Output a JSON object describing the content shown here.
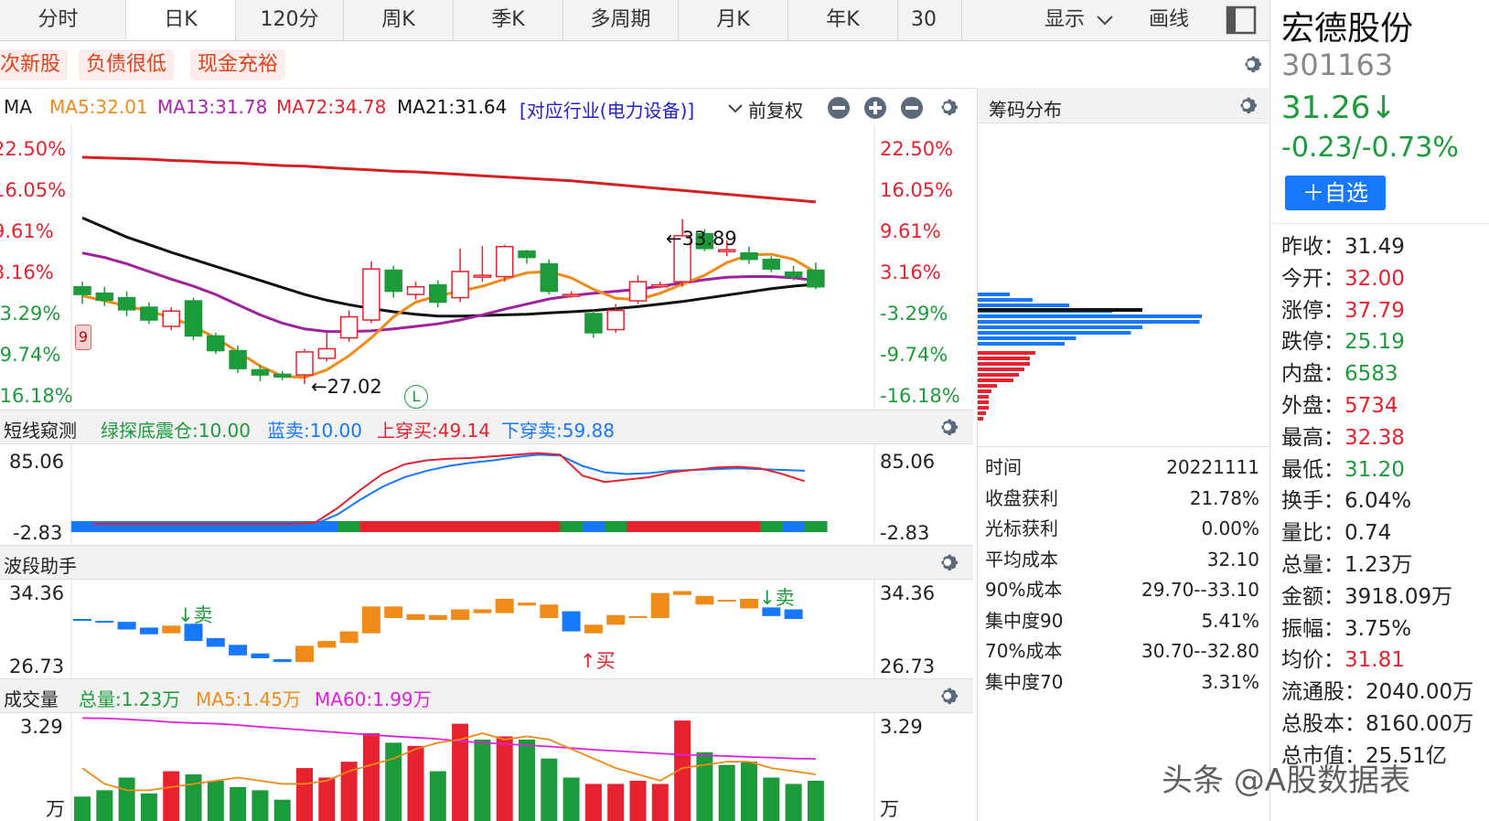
{
  "tabs": [
    "分时",
    "日K",
    "120分",
    "周K",
    "季K",
    "多周期",
    "月K",
    "年K",
    "30"
  ],
  "active_tab": 1,
  "tab_extra": {
    "display": "显示",
    "draw": "画线"
  },
  "tags": [
    "次新股",
    "负债很低",
    "现金充裕"
  ],
  "ma_header": {
    "label": "MA",
    "ma5": "MA5:32.01",
    "ma13": "MA13:31.78",
    "ma72": "MA72:34.78",
    "ma21": "MA21:31.64",
    "industry": "[对应行业(电力设备)]",
    "adjust": "前复权"
  },
  "colors": {
    "red": "#e8212e",
    "green": "#1c9b3b",
    "blue": "#1677ff",
    "orange": "#f08a18",
    "purple": "#a020a0",
    "black": "#111111"
  },
  "main_axis": [
    "22.50%",
    "16.05%",
    "9.61%",
    "3.16%",
    "-3.29%",
    "-9.74%",
    "-16.18%"
  ],
  "main_annotations": {
    "high": "←33.89",
    "low": "←27.02",
    "badge": "9",
    "circle": "L"
  },
  "candles": [
    {
      "o": 1.2,
      "c": 0.0,
      "h": 2.0,
      "l": -1.5
    },
    {
      "o": 0.2,
      "c": -0.9,
      "h": 1.2,
      "l": -1.8
    },
    {
      "o": -0.5,
      "c": -2.4,
      "h": 0.5,
      "l": -3.4
    },
    {
      "o": -2.0,
      "c": -4.0,
      "h": -1.2,
      "l": -4.6
    },
    {
      "o": -5.0,
      "c": -2.6,
      "h": -2.0,
      "l": -5.6
    },
    {
      "o": -1.0,
      "c": -6.5,
      "h": -0.5,
      "l": -7.2
    },
    {
      "o": -6.5,
      "c": -8.8,
      "h": -6.0,
      "l": -9.3
    },
    {
      "o": -8.8,
      "c": -11.6,
      "h": -8.0,
      "l": -12.3
    },
    {
      "o": -11.8,
      "c": -12.6,
      "h": -11.0,
      "l": -13.6
    },
    {
      "o": -12.5,
      "c": -12.9,
      "h": -12.0,
      "l": -13.4
    },
    {
      "o": -12.6,
      "c": -9.0,
      "h": -8.5,
      "l": -14.0
    },
    {
      "o": -10.0,
      "c": -8.5,
      "h": -6.0,
      "l": -10.5
    },
    {
      "o": -6.8,
      "c": -3.5,
      "h": -2.5,
      "l": -7.4
    },
    {
      "o": -4.0,
      "c": 4.0,
      "h": 5.2,
      "l": -4.5
    },
    {
      "o": 3.8,
      "c": 0.5,
      "h": 4.5,
      "l": -0.5
    },
    {
      "o": 0.0,
      "c": 1.2,
      "h": 2.0,
      "l": -0.8
    },
    {
      "o": 1.5,
      "c": -1.2,
      "h": 2.2,
      "l": -2.0
    },
    {
      "o": -0.5,
      "c": 3.6,
      "h": 7.2,
      "l": -1.2
    },
    {
      "o": 3.0,
      "c": 3.0,
      "h": 7.6,
      "l": 2.0
    },
    {
      "o": 2.8,
      "c": 7.5,
      "h": 7.8,
      "l": 2.0
    },
    {
      "o": 6.8,
      "c": 5.8,
      "h": 7.0,
      "l": 4.8
    },
    {
      "o": 4.8,
      "c": 0.5,
      "h": 5.5,
      "l": 0.0
    },
    {
      "o": 0.0,
      "c": 0.0,
      "h": 0.5,
      "l": -0.5
    },
    {
      "o": -3.0,
      "c": -6.0,
      "h": -2.5,
      "l": -6.8
    },
    {
      "o": -5.5,
      "c": -2.5,
      "h": -1.5,
      "l": -6.0
    },
    {
      "o": -1.0,
      "c": 2.0,
      "h": 3.0,
      "l": -1.5
    },
    {
      "o": 1.5,
      "c": 1.5,
      "h": 2.0,
      "l": 1.0
    },
    {
      "o": 2.0,
      "c": 9.2,
      "h": 11.8,
      "l": 1.2
    },
    {
      "o": 9.5,
      "c": 7.2,
      "h": 10.2,
      "l": 6.8
    },
    {
      "o": 7.0,
      "c": 7.0,
      "h": 8.5,
      "l": 6.0
    },
    {
      "o": 6.5,
      "c": 5.5,
      "h": 7.5,
      "l": 4.8
    },
    {
      "o": 5.5,
      "c": 4.0,
      "h": 6.0,
      "l": 3.5
    },
    {
      "o": 3.5,
      "c": 2.8,
      "h": 4.5,
      "l": 2.2
    },
    {
      "o": 3.8,
      "c": 1.2,
      "h": 5.0,
      "l": 0.8
    }
  ],
  "ma_lines": {
    "ma72": [
      21.5,
      21.4,
      21.3,
      21.2,
      21.0,
      20.9,
      20.7,
      20.6,
      20.4,
      20.2,
      20.1,
      19.9,
      19.7,
      19.5,
      19.3,
      19.2,
      19.0,
      18.8,
      18.6,
      18.4,
      18.2,
      18.0,
      17.8,
      17.5,
      17.2,
      16.9,
      16.6,
      16.3,
      16.0,
      15.7,
      15.4,
      15.1,
      14.8,
      14.5
    ],
    "ma21": [
      12.0,
      10.5,
      9.0,
      7.8,
      6.6,
      5.5,
      4.4,
      3.3,
      2.2,
      1.1,
      0.0,
      -0.9,
      -1.6,
      -2.2,
      -2.7,
      -3.1,
      -3.4,
      -3.4,
      -3.3,
      -3.2,
      -3.1,
      -2.9,
      -2.7,
      -2.5,
      -2.2,
      -1.9,
      -1.5,
      -1.1,
      -0.6,
      -0.1,
      0.4,
      0.9,
      1.3,
      1.6
    ],
    "ma13": [
      6.5,
      5.8,
      4.8,
      3.6,
      2.4,
      1.3,
      0.0,
      -1.6,
      -3.2,
      -4.5,
      -5.4,
      -5.8,
      -5.8,
      -5.7,
      -5.4,
      -5.0,
      -4.6,
      -4.0,
      -3.2,
      -2.3,
      -1.5,
      -0.7,
      -0.2,
      0.2,
      0.5,
      0.8,
      1.3,
      1.8,
      2.3,
      2.7,
      2.8,
      2.8,
      2.6,
      2.2
    ],
    "ma5": [
      -0.2,
      -1.0,
      -1.8,
      -2.6,
      -3.6,
      -5.0,
      -6.8,
      -9.0,
      -11.2,
      -12.8,
      -13.0,
      -11.8,
      -9.6,
      -6.8,
      -3.5,
      -1.2,
      -0.2,
      0.5,
      1.3,
      2.4,
      3.4,
      3.6,
      2.6,
      0.8,
      -0.6,
      -0.8,
      0.2,
      1.6,
      3.0,
      5.0,
      6.2,
      6.3,
      5.5,
      3.5
    ]
  },
  "chip_header": "筹码分布",
  "chip_bars": {
    "blue": [
      14,
      24,
      40,
      59,
      98,
      97,
      72,
      67,
      43,
      38
    ],
    "red": [
      21,
      19,
      19,
      17,
      15,
      13,
      7,
      5,
      4,
      4,
      4,
      3,
      2
    ]
  },
  "chip_stats": [
    {
      "k": "时间",
      "v": "20221111"
    },
    {
      "k": "收盘获利",
      "v": "21.78%"
    },
    {
      "k": "光标获利",
      "v": "0.00%"
    },
    {
      "k": "平均成本",
      "v": "32.10"
    },
    {
      "k": "90%成本",
      "v": "29.70--33.10"
    },
    {
      "k": "集中度90",
      "v": "5.41%"
    },
    {
      "k": "70%成本",
      "v": "30.70--32.80"
    },
    {
      "k": "集中度70",
      "v": "3.31%"
    }
  ],
  "short_panel": {
    "title": "短线窥测",
    "g": "绿探底震仓:10.00",
    "b": "蓝卖:10.00",
    "r": "上穿买:49.14",
    "p": "下穿卖:59.88",
    "axis_top": "85.06",
    "axis_bot": "-2.83",
    "red_line": [
      0,
      0,
      0,
      0,
      0,
      0,
      0,
      0,
      0,
      0,
      2,
      20,
      42,
      62,
      74,
      79,
      81,
      82,
      84,
      86,
      88,
      86,
      60,
      52,
      55,
      58,
      64,
      67,
      70,
      71,
      69,
      62,
      53
    ],
    "blue_line": [
      0,
      0,
      0,
      0,
      0,
      0,
      0,
      0,
      0,
      0,
      0,
      12,
      30,
      46,
      58,
      66,
      72,
      76,
      79,
      83,
      86,
      85,
      72,
      64,
      62,
      63,
      66,
      67,
      68,
      69,
      68,
      67,
      66
    ],
    "band": [
      "b",
      "b",
      "b",
      "b",
      "b",
      "b",
      "b",
      "b",
      "b",
      "b",
      "b",
      "b",
      "g",
      "r",
      "r",
      "r",
      "r",
      "r",
      "r",
      "r",
      "r",
      "r",
      "g",
      "b",
      "g",
      "r",
      "r",
      "r",
      "r",
      "r",
      "r",
      "g",
      "b",
      "g"
    ]
  },
  "wave_panel": {
    "title": "波段助手",
    "axis_top": "34.36",
    "axis_bot": "26.73",
    "sell1": "↓卖",
    "sell2": "↓卖",
    "buy": "↑买",
    "bars": [
      {
        "c": "b",
        "a": 31.5,
        "b": 31.3
      },
      {
        "c": "b",
        "a": 31.3,
        "b": 31.2
      },
      {
        "c": "b",
        "a": 31.2,
        "b": 30.4
      },
      {
        "c": "b",
        "a": 30.6,
        "b": 29.9
      },
      {
        "c": "o",
        "a": 30.8,
        "b": 30.0
      },
      {
        "c": "b",
        "a": 31.0,
        "b": 29.2
      },
      {
        "c": "b",
        "a": 29.5,
        "b": 28.6
      },
      {
        "c": "b",
        "a": 28.8,
        "b": 27.7
      },
      {
        "c": "b",
        "a": 27.9,
        "b": 27.4
      },
      {
        "c": "b",
        "a": 27.3,
        "b": 27.0
      },
      {
        "c": "o",
        "a": 27.0,
        "b": 28.7
      },
      {
        "c": "o",
        "a": 28.5,
        "b": 29.2
      },
      {
        "c": "o",
        "a": 29.0,
        "b": 30.2
      },
      {
        "c": "o",
        "a": 30.0,
        "b": 32.8
      },
      {
        "c": "o",
        "a": 31.6,
        "b": 32.8
      },
      {
        "c": "o",
        "a": 31.4,
        "b": 32.0
      },
      {
        "c": "o",
        "a": 31.4,
        "b": 31.9
      },
      {
        "c": "o",
        "a": 31.4,
        "b": 32.5
      },
      {
        "c": "o",
        "a": 32.1,
        "b": 32.5
      },
      {
        "c": "o",
        "a": 32.1,
        "b": 33.6
      },
      {
        "c": "o",
        "a": 32.9,
        "b": 33.2
      },
      {
        "c": "o",
        "a": 31.6,
        "b": 33.0
      },
      {
        "c": "b",
        "a": 32.3,
        "b": 30.2
      },
      {
        "c": "o",
        "a": 30.0,
        "b": 30.9
      },
      {
        "c": "o",
        "a": 30.9,
        "b": 31.9
      },
      {
        "c": "o",
        "a": 31.6,
        "b": 31.8
      },
      {
        "c": "o",
        "a": 31.6,
        "b": 34.2
      },
      {
        "c": "o",
        "a": 34.0,
        "b": 34.4
      },
      {
        "c": "o",
        "a": 33.9,
        "b": 33.0
      },
      {
        "c": "o",
        "a": 33.5,
        "b": 33.3
      },
      {
        "c": "o",
        "a": 33.6,
        "b": 32.6
      },
      {
        "c": "b",
        "a": 32.7,
        "b": 31.8
      },
      {
        "c": "b",
        "a": 32.5,
        "b": 31.5
      }
    ]
  },
  "vol_panel": {
    "title": "成交量",
    "total": "总量:1.23万",
    "ma5": "MA5:1.45万",
    "ma60": "MA60:1.99万",
    "axis_top": "3.29",
    "unit": "万",
    "bars": [
      {
        "v": 0.8,
        "c": "g"
      },
      {
        "v": 1.0,
        "c": "g"
      },
      {
        "v": 1.4,
        "c": "g"
      },
      {
        "v": 0.9,
        "c": "g"
      },
      {
        "v": 1.6,
        "c": "r"
      },
      {
        "v": 1.5,
        "c": "g"
      },
      {
        "v": 1.3,
        "c": "g"
      },
      {
        "v": 1.1,
        "c": "g"
      },
      {
        "v": 1.0,
        "c": "g"
      },
      {
        "v": 0.7,
        "c": "g"
      },
      {
        "v": 1.7,
        "c": "r"
      },
      {
        "v": 1.4,
        "c": "r"
      },
      {
        "v": 1.9,
        "c": "r"
      },
      {
        "v": 2.8,
        "c": "r"
      },
      {
        "v": 2.5,
        "c": "g"
      },
      {
        "v": 2.4,
        "c": "r"
      },
      {
        "v": 1.6,
        "c": "g"
      },
      {
        "v": 3.1,
        "c": "r"
      },
      {
        "v": 2.6,
        "c": "g"
      },
      {
        "v": 2.7,
        "c": "r"
      },
      {
        "v": 2.6,
        "c": "g"
      },
      {
        "v": 2.0,
        "c": "g"
      },
      {
        "v": 1.4,
        "c": "g"
      },
      {
        "v": 1.2,
        "c": "r"
      },
      {
        "v": 1.2,
        "c": "r"
      },
      {
        "v": 1.3,
        "c": "r"
      },
      {
        "v": 1.2,
        "c": "r"
      },
      {
        "v": 3.2,
        "c": "r"
      },
      {
        "v": 2.2,
        "c": "g"
      },
      {
        "v": 1.8,
        "c": "g"
      },
      {
        "v": 1.9,
        "c": "g"
      },
      {
        "v": 1.4,
        "c": "g"
      },
      {
        "v": 1.2,
        "c": "g"
      },
      {
        "v": 1.3,
        "c": "g"
      }
    ],
    "ma5_line": [
      1.7,
      1.2,
      1.0,
      1.0,
      1.1,
      1.2,
      1.3,
      1.4,
      1.3,
      1.2,
      1.2,
      1.3,
      1.6,
      1.8,
      2.0,
      2.3,
      2.5,
      2.6,
      2.8,
      2.6,
      2.7,
      2.6,
      2.3,
      2.0,
      1.7,
      1.5,
      1.3,
      1.7,
      1.8,
      1.9,
      1.9,
      1.7,
      1.6,
      1.5
    ],
    "ma60_line": [
      3.28,
      3.27,
      3.24,
      3.2,
      3.15,
      3.12,
      3.1,
      3.06,
      3.0,
      2.95,
      2.9,
      2.85,
      2.8,
      2.75,
      2.7,
      2.66,
      2.62,
      2.55,
      2.5,
      2.46,
      2.42,
      2.38,
      2.33,
      2.28,
      2.24,
      2.2,
      2.16,
      2.12,
      2.1,
      2.08,
      2.05,
      2.03,
      2.0,
      1.99
    ]
  },
  "stock": {
    "name": "宏德股份",
    "code": "301163",
    "price": "31.26↓",
    "change": "-0.23/-0.73%",
    "add_button": "＋自选",
    "stats": [
      {
        "k": "昨收：",
        "v": "31.49",
        "c": "black"
      },
      {
        "k": "今开：",
        "v": "32.00",
        "c": "red"
      },
      {
        "k": "涨停：",
        "v": "37.79",
        "c": "red"
      },
      {
        "k": "跌停：",
        "v": "25.19",
        "c": "green"
      },
      {
        "k": "内盘：",
        "v": "6583",
        "c": "green"
      },
      {
        "k": "外盘：",
        "v": "5734",
        "c": "red"
      },
      {
        "k": "最高：",
        "v": "32.38",
        "c": "red"
      },
      {
        "k": "最低：",
        "v": "31.20",
        "c": "green"
      },
      {
        "k": "换手：",
        "v": "6.04%",
        "c": "black"
      },
      {
        "k": "量比：",
        "v": "0.74",
        "c": "black"
      },
      {
        "k": "总量：",
        "v": "1.23万",
        "c": "black"
      },
      {
        "k": "金额：",
        "v": "3918.09万",
        "c": "black"
      },
      {
        "k": "振幅：",
        "v": "3.75%",
        "c": "black"
      },
      {
        "k": "均价：",
        "v": "31.81",
        "c": "red"
      },
      {
        "k": "流通股：",
        "v": "2040.00万",
        "c": "black"
      },
      {
        "k": "总股本：",
        "v": "8160.00万",
        "c": "black"
      },
      {
        "k": "总市值：",
        "v": "25.51亿",
        "c": "black"
      }
    ]
  },
  "watermark": "头条 @A股数据表"
}
